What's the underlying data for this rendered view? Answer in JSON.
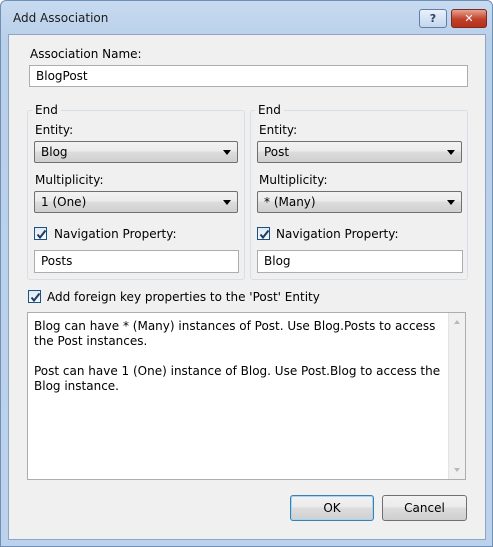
{
  "window": {
    "title": "Add Association",
    "help_label": "?",
    "close_label": "✕"
  },
  "association_name": {
    "label": "Association Name:",
    "value": "BlogPost"
  },
  "end_left": {
    "caption": "End",
    "entity_label": "Entity:",
    "entity_value": "Blog",
    "multiplicity_label": "Multiplicity:",
    "multiplicity_value": "1 (One)",
    "nav_checkbox_label": "Navigation Property:",
    "nav_checked": true,
    "nav_value": "Posts"
  },
  "end_right": {
    "caption": "End",
    "entity_label": "Entity:",
    "entity_value": "Post",
    "multiplicity_label": "Multiplicity:",
    "multiplicity_value": "* (Many)",
    "nav_checkbox_label": "Navigation Property:",
    "nav_checked": true,
    "nav_value": "Blog"
  },
  "foreign_key": {
    "label": "Add foreign key properties to the 'Post' Entity",
    "checked": true
  },
  "description": {
    "line1": "Blog can have * (Many) instances of Post. Use Blog.Posts to access the Post instances.",
    "line2": "Post can have 1 (One) instance of Blog. Use Post.Blog to access the Blog instance."
  },
  "buttons": {
    "ok": "OK",
    "cancel": "Cancel"
  },
  "icons": {
    "checkbox_check": "checkmark-icon",
    "dropdown": "chevron-down-icon",
    "scroll_up": "scroll-up-arrow-icon",
    "scroll_down": "scroll-down-arrow-icon"
  }
}
